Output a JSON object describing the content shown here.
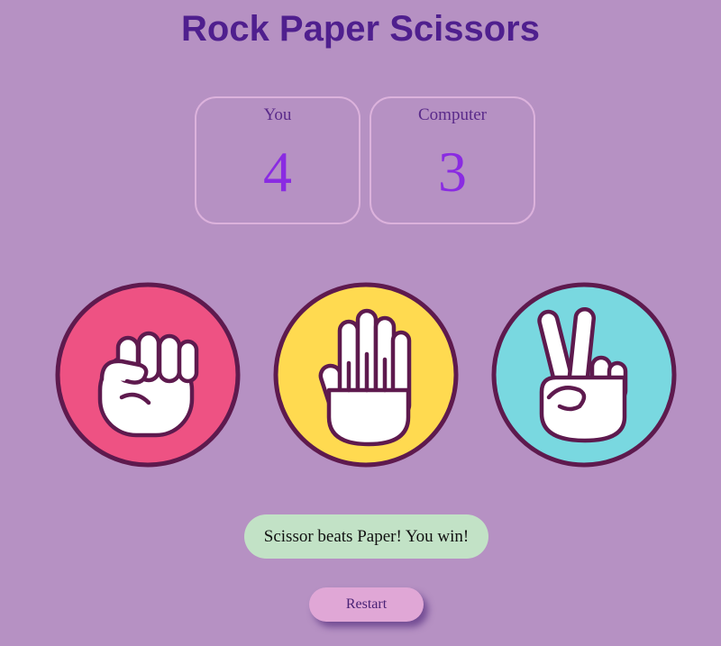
{
  "app": {
    "title": "Rock Paper Scissors"
  },
  "scoreboard": {
    "player": {
      "label": "You",
      "score": "4"
    },
    "computer": {
      "label": "Computer",
      "score": "3"
    }
  },
  "choices": [
    {
      "name": "rock",
      "icon": "fist-hand-icon",
      "color": "#ee5283"
    },
    {
      "name": "paper",
      "icon": "open-hand-icon",
      "color": "#ffda50"
    },
    {
      "name": "scissors",
      "icon": "peace-hand-icon",
      "color": "#79d8e0"
    }
  ],
  "result": {
    "message": "Scissor beats Paper! You win!",
    "color": "#c2e2c6"
  },
  "controls": {
    "restart_label": "Restart"
  },
  "colors": {
    "background": "#b691c3",
    "title": "#4f1f8e",
    "score_value": "#8a2be2",
    "outline": "#5e1a4e"
  }
}
